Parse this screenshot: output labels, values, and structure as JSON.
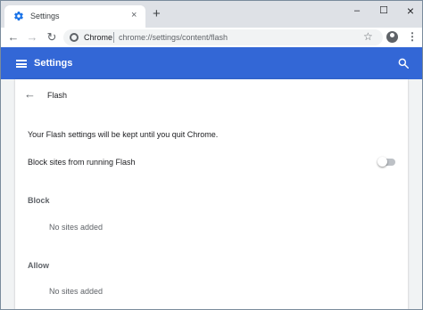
{
  "tab": {
    "title": "Settings",
    "close": "×"
  },
  "window_controls": {
    "minimize": "–",
    "maximize": "☐",
    "close": "×"
  },
  "new_tab_label": "+",
  "toolbar": {
    "back": "←",
    "forward": "→",
    "reload": "↻",
    "site_chip": "Chrome",
    "url": "chrome://settings/content/flash",
    "star": "☆",
    "menu": "⋮"
  },
  "header": {
    "title": "Settings"
  },
  "subpage": {
    "back": "←",
    "title": "Flash",
    "notice": "Your Flash settings will be kept until you quit Chrome.",
    "block_sites_label": "Block sites from running Flash",
    "block_sites_enabled": false,
    "block": {
      "label": "Block",
      "empty": "No sites added"
    },
    "allow": {
      "label": "Allow",
      "empty": "No sites added"
    }
  },
  "colors": {
    "accent": "#3367d6",
    "tabstrip": "#dee1e6",
    "content_bg": "#f1f3f4"
  },
  "icons": {
    "tab_favicon": "gear-icon",
    "site": "chrome-info-icon",
    "search": "search-icon",
    "menu": "hamburger-icon",
    "profile": "account-circle-icon"
  }
}
